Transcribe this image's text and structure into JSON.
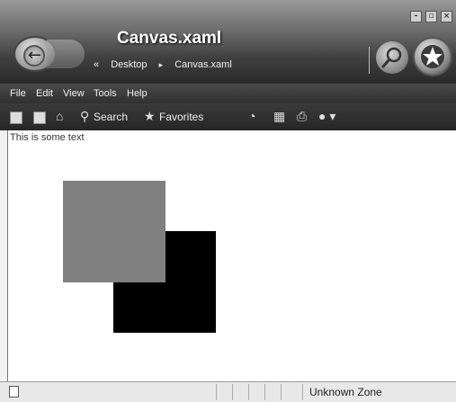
{
  "window": {
    "title": "Canvas.xaml",
    "breadcrumb": {
      "prefix": "«",
      "items": [
        "Desktop",
        "Canvas.xaml"
      ],
      "separator": "▸"
    },
    "controls": {
      "minimize": "-",
      "maximize": "▫",
      "close": "×"
    }
  },
  "menu": {
    "items": [
      "File",
      "Edit",
      "View",
      "Tools",
      "Help"
    ]
  },
  "toolbar": {
    "search_label": "Search",
    "favorites_label": "Favorites"
  },
  "content": {
    "text": "This is some text",
    "shapes": [
      {
        "name": "gray-square",
        "color": "#808080"
      },
      {
        "name": "black-square",
        "color": "#000000"
      }
    ]
  },
  "status": {
    "zone": "Unknown Zone"
  },
  "icons": [
    "back-arrow-icon",
    "search-icon",
    "favorites-star-icon",
    "stop-icon",
    "refresh-icon",
    "home-icon",
    "history-icon",
    "print-icon",
    "messenger-icon",
    "page-icon"
  ]
}
